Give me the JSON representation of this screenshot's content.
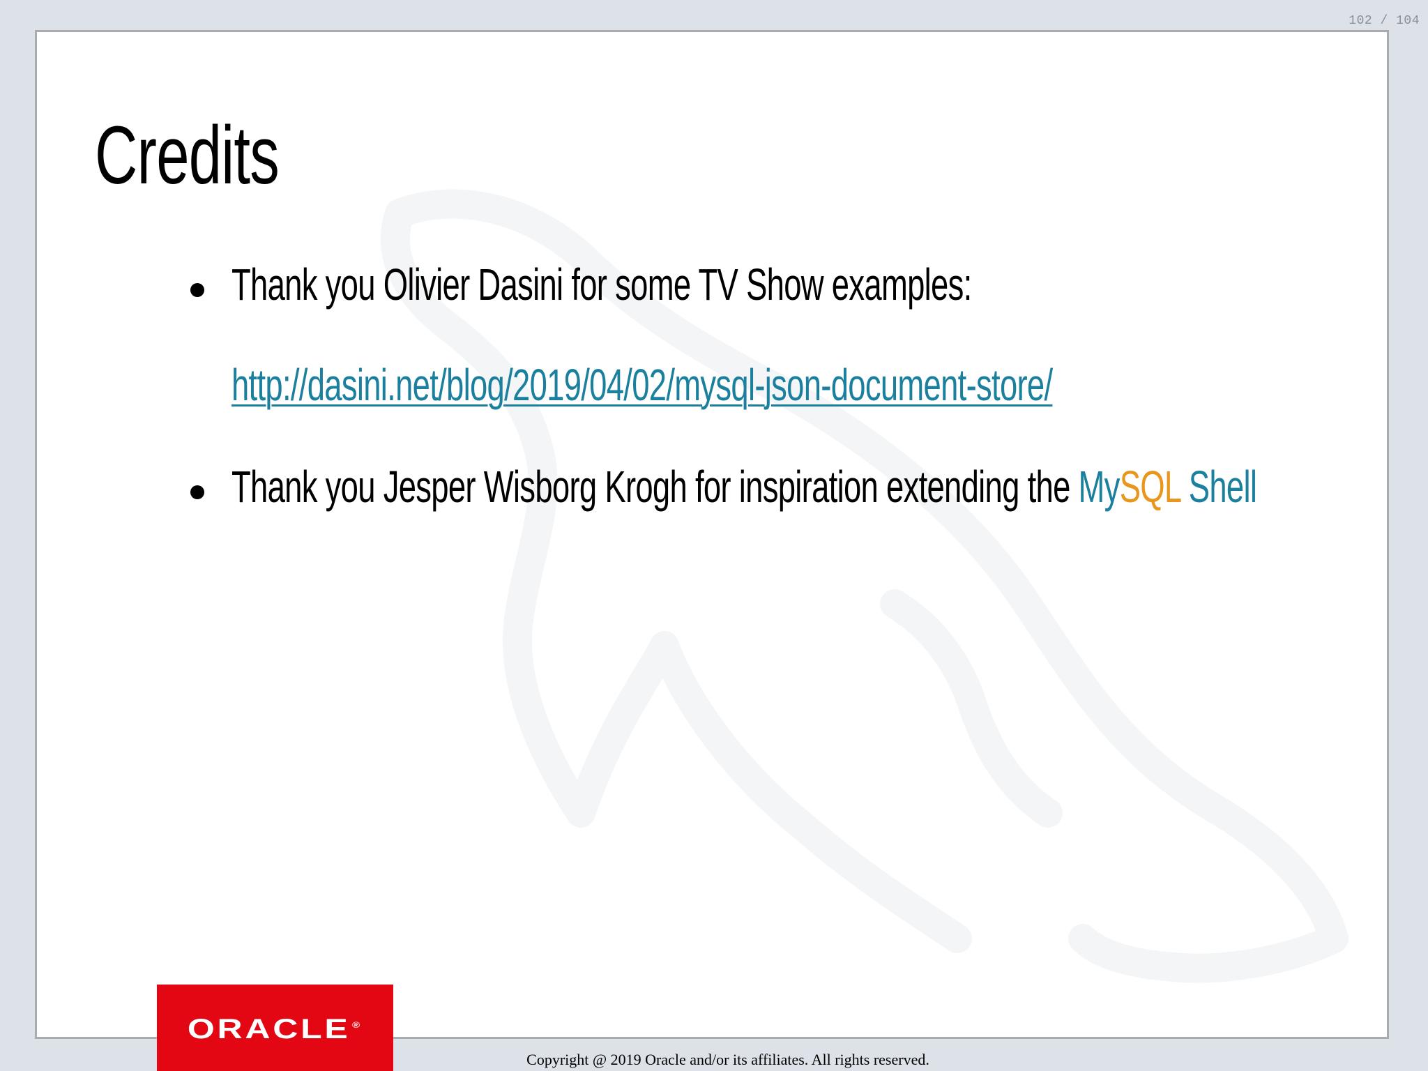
{
  "page_counter": "102 / 104",
  "slide": {
    "title": "Credits",
    "bullets": [
      {
        "text": "Thank you Olivier Dasini for some TV Show examples:"
      },
      {
        "link": "http://dasini.net/blog/2019/04/02/mysql-json-document-store/"
      },
      {
        "text": "Thank you Jesper Wisborg Krogh for inspiration extending the ",
        "brand_my": "My",
        "brand_sql": "SQL",
        "brand_shell": " Shell"
      }
    ]
  },
  "footer": {
    "logo_text": "ORACLE",
    "logo_mark": "®",
    "copyright": "Copyright @ 2019 Oracle and/or its affiliates. All rights reserved."
  },
  "colors": {
    "background": "#dde2e8",
    "link": "#1b7f9e",
    "mysql_orange": "#e8961d",
    "oracle_red": "#e2141b"
  }
}
